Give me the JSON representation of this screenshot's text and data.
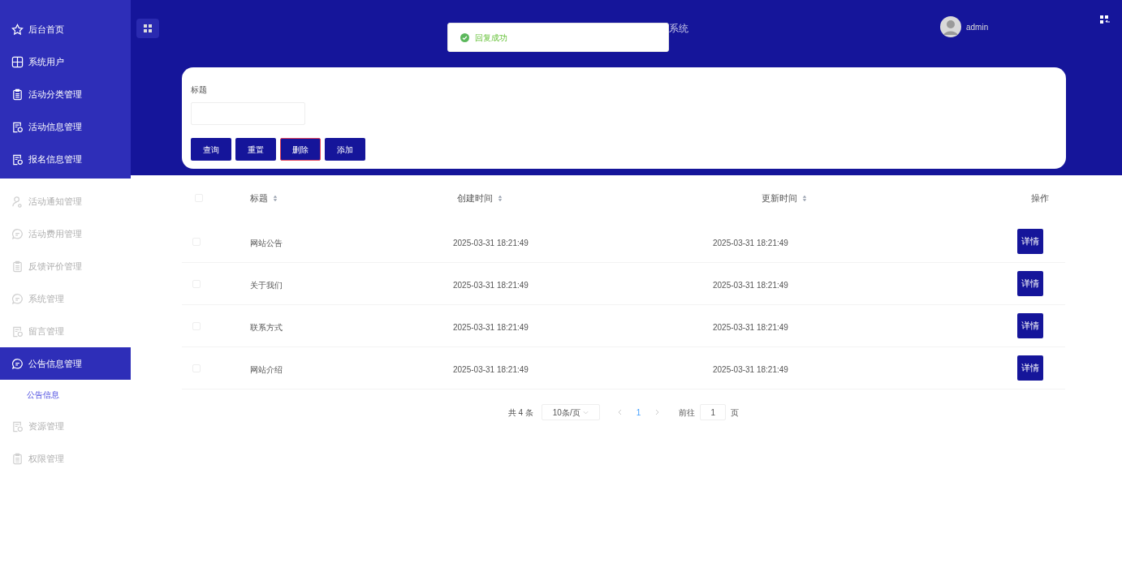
{
  "header": {
    "title_visible": "系统",
    "user": "admin"
  },
  "toast": {
    "message": "回复成功"
  },
  "sidebar": {
    "top_items": [
      {
        "label": "后台首页",
        "kind": "star",
        "selected": false
      },
      {
        "label": "系统用户",
        "kind": "grid",
        "selected": false
      },
      {
        "label": "活动分类管理",
        "kind": "clipboard",
        "selected": false
      },
      {
        "label": "活动信息管理",
        "kind": "doc",
        "selected": false
      },
      {
        "label": "报名信息管理",
        "kind": "doc",
        "selected": false
      }
    ],
    "items": [
      {
        "label": "活动通知管理",
        "kind": "user",
        "selected": false
      },
      {
        "label": "活动费用管理",
        "kind": "chat",
        "selected": false
      },
      {
        "label": "反馈评价管理",
        "kind": "clipboard",
        "selected": false
      },
      {
        "label": "系统管理",
        "kind": "chat",
        "selected": false
      },
      {
        "label": "留言管理",
        "kind": "doc",
        "selected": false
      },
      {
        "label": "公告信息管理",
        "kind": "chat",
        "selected": true,
        "children": [
          {
            "label": "公告信息",
            "selected": true
          }
        ]
      },
      {
        "label": "资源管理",
        "kind": "doc",
        "selected": false
      },
      {
        "label": "权限管理",
        "kind": "clipboard",
        "selected": false
      }
    ]
  },
  "search": {
    "label": "标题",
    "buttons": [
      {
        "label": "查询",
        "kind": "plain"
      },
      {
        "label": "重置",
        "kind": "plain"
      },
      {
        "label": "删除",
        "kind": "danger"
      },
      {
        "label": "添加",
        "kind": "plain"
      }
    ]
  },
  "table": {
    "select_all_checked": false,
    "columns": [
      "标题",
      "创建时间",
      "更新时间",
      "操作"
    ],
    "rows": [
      {
        "checked": false,
        "title": "网站公告",
        "created": "2025-03-31 18:21:49",
        "updated": "2025-03-31 18:21:49",
        "action": "详情"
      },
      {
        "checked": false,
        "title": "关于我们",
        "created": "2025-03-31 18:21:49",
        "updated": "2025-03-31 18:21:49",
        "action": "详情"
      },
      {
        "checked": false,
        "title": "联系方式",
        "created": "2025-03-31 18:21:49",
        "updated": "2025-03-31 18:21:49",
        "action": "详情"
      },
      {
        "checked": false,
        "title": "网站介绍",
        "created": "2025-03-31 18:21:49",
        "updated": "2025-03-31 18:21:49",
        "action": "详情"
      }
    ]
  },
  "pagination": {
    "total": "共 4 条",
    "page_size": "10条/页",
    "pages": [
      {
        "label": "1",
        "selected": true
      }
    ],
    "goto_label": "前往",
    "goto_value": "1",
    "goto_suffix": "页"
  }
}
